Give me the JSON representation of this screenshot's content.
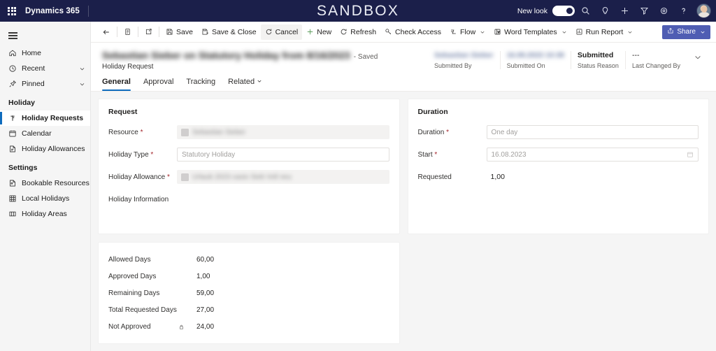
{
  "topbar": {
    "waffle_icon": "app-launcher-icon",
    "brand": "Dynamics 365",
    "environment_banner": "SANDBOX",
    "new_look_label": "New look",
    "new_look_state": "on",
    "icons": [
      "search-icon",
      "lightbulb-icon",
      "plus-icon",
      "filter-icon",
      "gear-icon",
      "help-icon"
    ],
    "background_color": "#1b1f4a"
  },
  "sidebar": {
    "hamburger_label": "Site map",
    "items": [
      {
        "label": "Home",
        "icon": "home-icon",
        "name": "home",
        "chevron": false,
        "selected": false
      },
      {
        "label": "Recent",
        "icon": "clock-icon",
        "name": "recent",
        "chevron": true,
        "selected": false
      },
      {
        "label": "Pinned",
        "icon": "pin-icon",
        "name": "pinned",
        "chevron": true,
        "selected": false
      }
    ],
    "groups": [
      {
        "title": "Holiday",
        "items": [
          {
            "label": "Holiday Requests",
            "icon": "holiday-request-icon",
            "name": "holiday-requests",
            "selected": true
          },
          {
            "label": "Calendar",
            "icon": "calendar-icon",
            "name": "calendar",
            "selected": false
          },
          {
            "label": "Holiday Allowances",
            "icon": "allowance-icon",
            "name": "holiday-allowances",
            "selected": false
          }
        ]
      },
      {
        "title": "Settings",
        "items": [
          {
            "label": "Bookable Resources",
            "icon": "resource-icon",
            "name": "bookable-resources",
            "selected": false
          },
          {
            "label": "Local Holidays",
            "icon": "grid-icon",
            "name": "local-holidays",
            "selected": false
          },
          {
            "label": "Holiday Areas",
            "icon": "columns-icon",
            "name": "holiday-areas",
            "selected": false
          }
        ]
      }
    ],
    "selected_accent": "#0f6cbd"
  },
  "commandbar": {
    "back_icon": "back-arrow-icon",
    "form_icon": "form-icon",
    "popout_icon": "open-in-new-icon",
    "commands": [
      {
        "label": "Save",
        "icon": "save-icon",
        "name": "save",
        "highlighted": false,
        "chevron": false
      },
      {
        "label": "Save & Close",
        "icon": "save-close-icon",
        "name": "save-and-close",
        "highlighted": false,
        "chevron": false
      },
      {
        "label": "Cancel",
        "icon": "cancel-icon",
        "name": "cancel",
        "highlighted": true,
        "chevron": false
      },
      {
        "label": "New",
        "icon": "plus-icon",
        "name": "new",
        "highlighted": false,
        "chevron": false
      },
      {
        "label": "Refresh",
        "icon": "refresh-icon",
        "name": "refresh",
        "highlighted": false,
        "chevron": false
      },
      {
        "label": "Check Access",
        "icon": "key-icon",
        "name": "check-access",
        "highlighted": false,
        "chevron": false
      },
      {
        "label": "Flow",
        "icon": "flow-icon",
        "name": "flow",
        "highlighted": false,
        "chevron": true
      },
      {
        "label": "Word Templates",
        "icon": "word-icon",
        "name": "word-templates",
        "highlighted": false,
        "chevron": true
      },
      {
        "label": "Run Report",
        "icon": "report-icon",
        "name": "run-report",
        "highlighted": false,
        "chevron": true
      }
    ],
    "share": {
      "label": "Share",
      "icon": "share-icon",
      "color": "#4f5db3"
    }
  },
  "record": {
    "title": "Sebastian Sieber on Statutory Holiday from 8/16/2023",
    "saved_text": "- Saved",
    "entity": "Holiday Request",
    "tabs": [
      {
        "label": "General",
        "active": true,
        "chevron": false
      },
      {
        "label": "Approval",
        "active": false,
        "chevron": false
      },
      {
        "label": "Tracking",
        "active": false,
        "chevron": false
      },
      {
        "label": "Related",
        "active": false,
        "chevron": true
      }
    ],
    "header_fields": [
      {
        "label": "Submitted By",
        "value": "Sebastian Sieber",
        "blurred": true,
        "strong": false
      },
      {
        "label": "Submitted On",
        "value": "16.08.2023 10:39",
        "blurred": true,
        "strong": false
      },
      {
        "label": "Status Reason",
        "value": "Submitted",
        "blurred": false,
        "strong": true
      },
      {
        "label": "Last Changed By",
        "value": "---",
        "blurred": false,
        "strong": false
      }
    ]
  },
  "request_card": {
    "title": "Request",
    "fields": [
      {
        "label": "Resource",
        "required": true,
        "value": "Sebastian Sieber",
        "style": "filled",
        "blurred": true,
        "lookup": true,
        "name": "resource"
      },
      {
        "label": "Holiday Type",
        "required": true,
        "value": "Statutory Holiday",
        "style": "outlined",
        "blurred": false,
        "lookup": false,
        "name": "holiday-type"
      },
      {
        "label": "Holiday Allowance",
        "required": true,
        "value": "Urlaub 2023 casio Sieb Voll neu",
        "style": "filled",
        "blurred": true,
        "lookup": true,
        "name": "holiday-allowance"
      },
      {
        "label": "Holiday Information",
        "required": false,
        "value": "",
        "style": "none",
        "blurred": false,
        "lookup": false,
        "name": "holiday-information"
      }
    ]
  },
  "duration_card": {
    "title": "Duration",
    "fields": [
      {
        "label": "Duration",
        "required": true,
        "value": "One day",
        "style": "outlined",
        "calendar": false,
        "name": "duration"
      },
      {
        "label": "Start",
        "required": true,
        "value": "16.08.2023",
        "style": "outlined",
        "calendar": true,
        "name": "start-date"
      },
      {
        "label": "Requested",
        "required": false,
        "value": "1,00",
        "style": "plain",
        "calendar": false,
        "name": "requested"
      }
    ]
  },
  "stats_card": {
    "rows": [
      {
        "label": "Allowed Days",
        "value": "60,00",
        "locked": false
      },
      {
        "label": "Approved Days",
        "value": "1,00",
        "locked": false
      },
      {
        "label": "Remaining Days",
        "value": "59,00",
        "locked": false
      },
      {
        "label": "Total Requested Days",
        "value": "27,00",
        "locked": false
      },
      {
        "label": "Not Approved",
        "value": "24,00",
        "locked": true
      }
    ]
  }
}
